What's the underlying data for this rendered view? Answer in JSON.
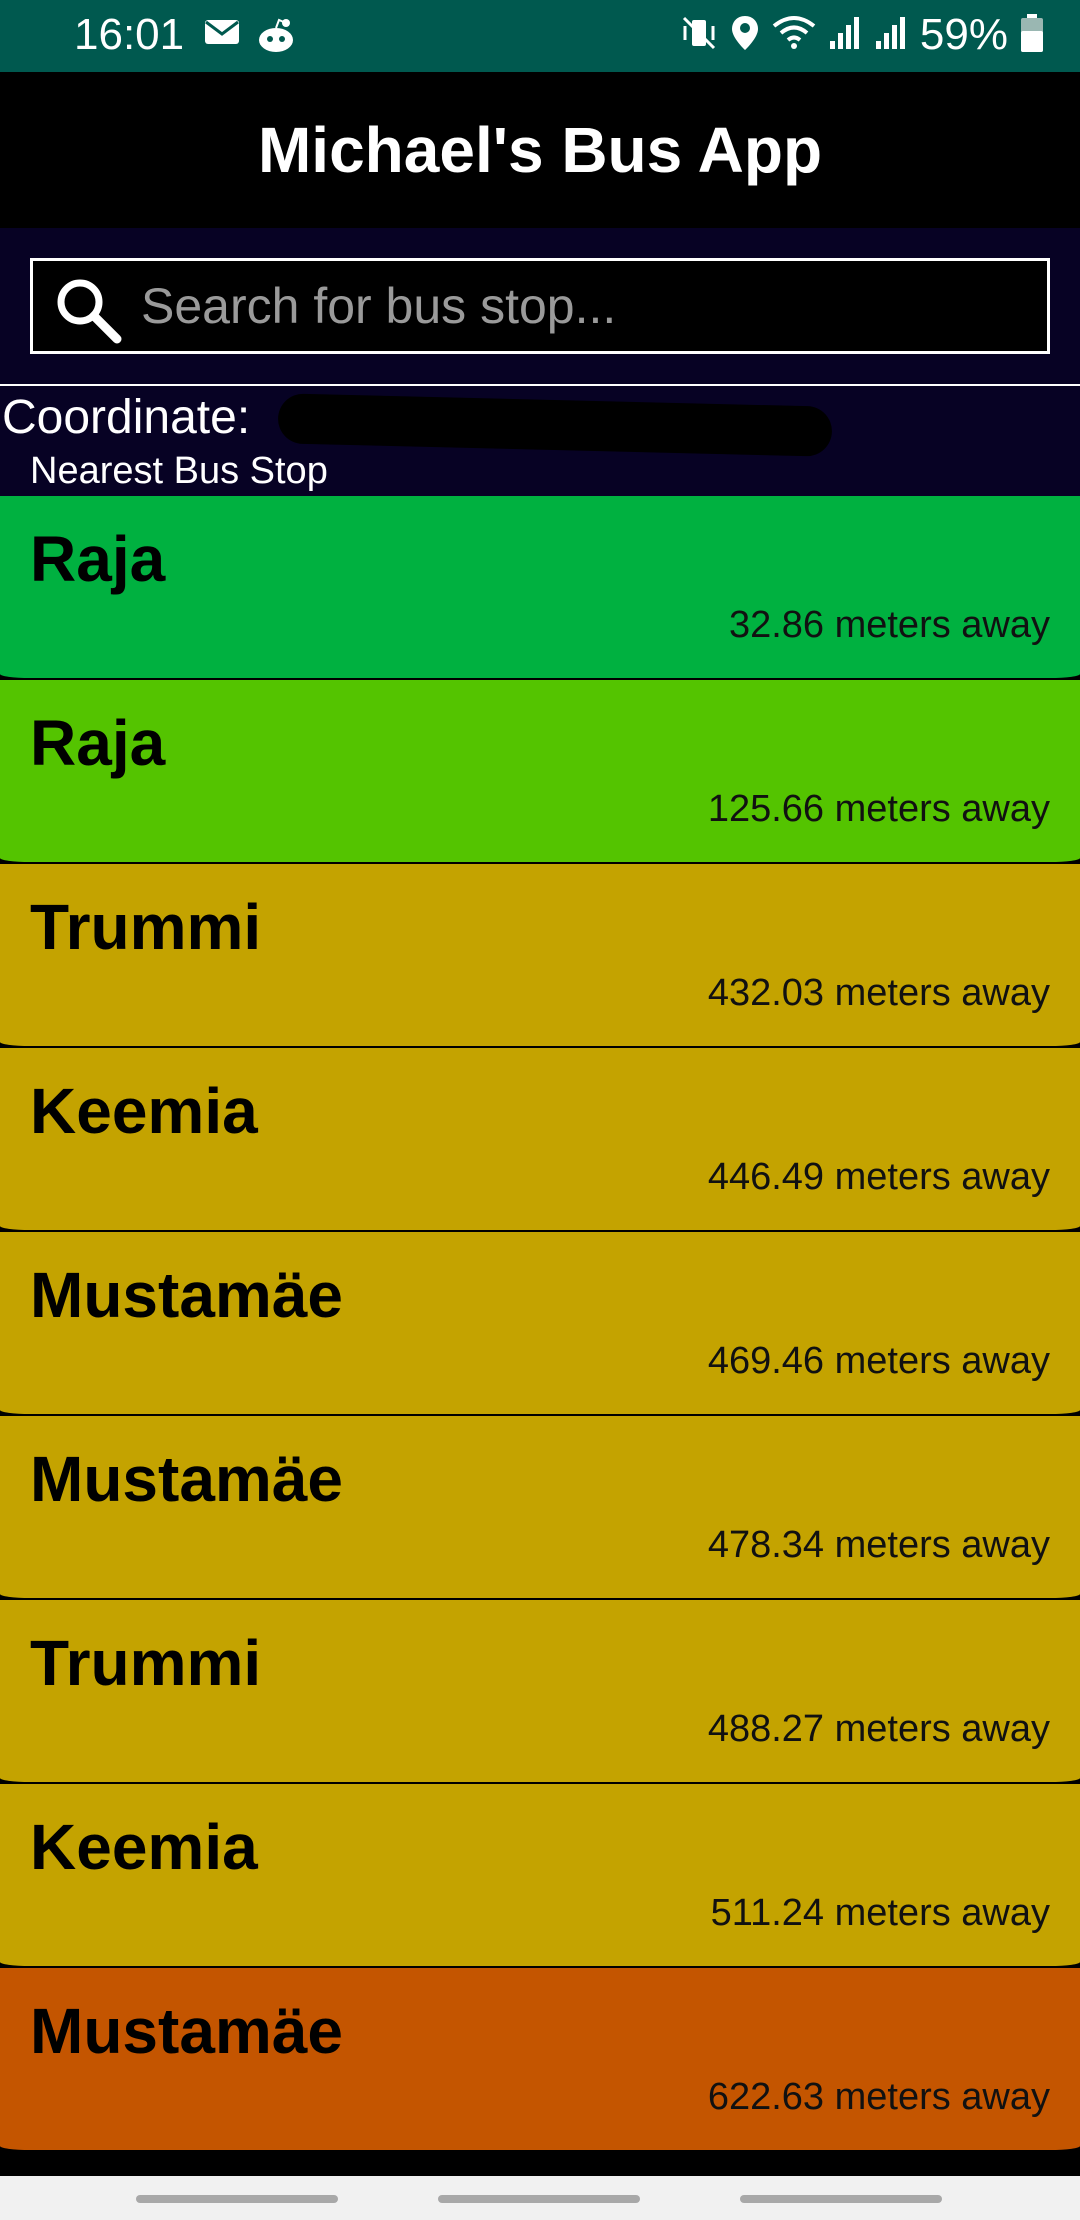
{
  "status_bar": {
    "time": "16:01",
    "left_icons": [
      "mail-icon",
      "reddit-icon"
    ],
    "right_icons": [
      "mute-vibrate-icon",
      "location-icon",
      "wifi-icon",
      "signal-icon",
      "signal-icon"
    ],
    "battery_percent": "59%"
  },
  "header": {
    "title": "Michael's Bus App"
  },
  "search": {
    "placeholder": "Search for bus stop...",
    "value": ""
  },
  "location": {
    "coordinate_label": "Coordinate:",
    "nearest_label": "Nearest Bus Stop"
  },
  "stops": [
    {
      "name": "Raja",
      "distance": "32.86 meters away",
      "color": "#00b140"
    },
    {
      "name": "Raja",
      "distance": "125.66 meters away",
      "color": "#54c400"
    },
    {
      "name": "Trummi",
      "distance": "432.03 meters away",
      "color": "#c4a300"
    },
    {
      "name": "Keemia",
      "distance": "446.49 meters away",
      "color": "#c4a300"
    },
    {
      "name": "Mustamäe",
      "distance": "469.46 meters away",
      "color": "#c4a300"
    },
    {
      "name": "Mustamäe",
      "distance": "478.34 meters away",
      "color": "#c4a300"
    },
    {
      "name": "Trummi",
      "distance": "488.27 meters away",
      "color": "#c4a300"
    },
    {
      "name": "Keemia",
      "distance": "511.24 meters away",
      "color": "#c4a300"
    },
    {
      "name": "Mustamäe",
      "distance": "622.63 meters away",
      "color": "#c45500"
    }
  ],
  "colors": {
    "status_bar": "#00594f",
    "header": "#000000",
    "search_area": "#070224"
  }
}
